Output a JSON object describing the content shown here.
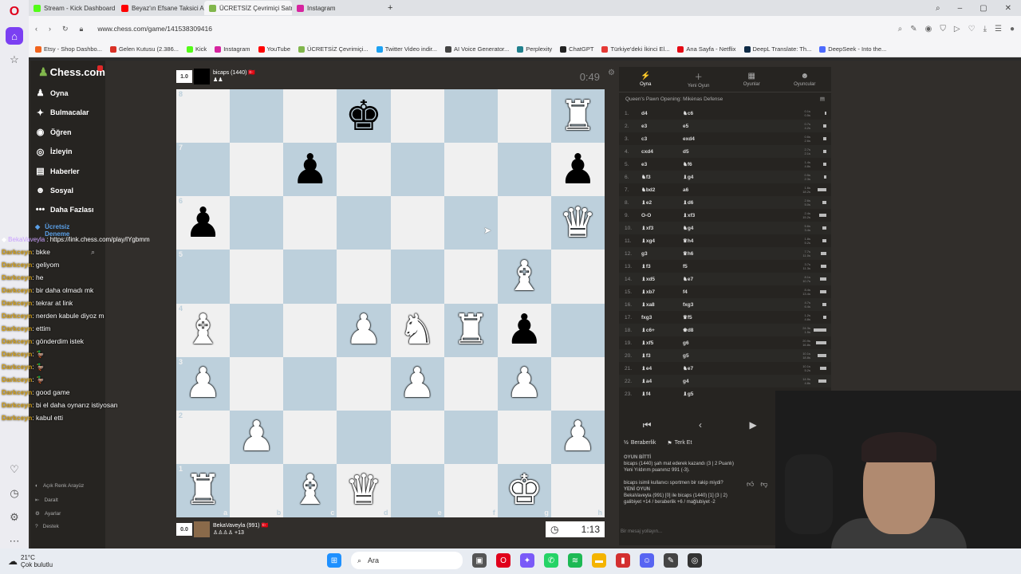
{
  "browser": {
    "tabs": [
      {
        "label": "Stream - Kick Dashboard",
        "color": "#53fc18"
      },
      {
        "label": "Beyaz'ın Efsane Taksici Anı",
        "color": "#ff0000"
      },
      {
        "label": "ÜCRETSİZ Çevrimiçi Satranç",
        "color": "#81b64c"
      },
      {
        "label": "Instagram",
        "color": "#d6249f"
      }
    ],
    "new_tab": "+",
    "url": "www.chess.com/game/141538309416",
    "bookmarks": [
      {
        "label": "Etsy - Shop Dashbo...",
        "color": "#f1641e"
      },
      {
        "label": "Gelen Kutusu (2.386...",
        "color": "#d93025"
      },
      {
        "label": "Kick",
        "color": "#53fc18"
      },
      {
        "label": "Instagram",
        "color": "#d6249f"
      },
      {
        "label": "YouTube",
        "color": "#ff0000"
      },
      {
        "label": "ÜCRETSİZ Çevrimiçi...",
        "color": "#81b64c"
      },
      {
        "label": "Twitter Video indir...",
        "color": "#1da1f2"
      },
      {
        "label": "AI Voice Generator...",
        "color": "#444444"
      },
      {
        "label": "Perplexity",
        "color": "#20808d"
      },
      {
        "label": "ChatGPT",
        "color": "#222222"
      },
      {
        "label": "Türkiye'deki İkinci El...",
        "color": "#e53935"
      },
      {
        "label": "Ana Sayfa - Netflix",
        "color": "#e50914"
      },
      {
        "label": "DeepL Translate: Th...",
        "color": "#0f2b46"
      },
      {
        "label": "DeepSeek - Into the...",
        "color": "#4d6bfe"
      }
    ]
  },
  "sidebar": {
    "logo": "Chess.com",
    "items": [
      {
        "label": "Oyna",
        "icon": "pawn-icon",
        "glyph": "♟"
      },
      {
        "label": "Bulmacalar",
        "icon": "puzzle-icon",
        "glyph": "✦"
      },
      {
        "label": "Öğren",
        "icon": "learn-icon",
        "glyph": "◉"
      },
      {
        "label": "İzleyin",
        "icon": "watch-icon",
        "glyph": "◎"
      },
      {
        "label": "Haberler",
        "icon": "news-icon",
        "glyph": "▤"
      },
      {
        "label": "Sosyal",
        "icon": "social-icon",
        "glyph": "☻"
      },
      {
        "label": "Daha Fazlası",
        "icon": "more-icon",
        "glyph": "•••"
      }
    ],
    "trial": "Ücretsiz Deneme",
    "bottom": [
      {
        "label": "Açık Renk Arayüz",
        "glyph": "◐"
      },
      {
        "label": "Daralt",
        "glyph": "⇤"
      },
      {
        "label": "Ayarlar",
        "glyph": "⚙"
      },
      {
        "label": "Destek",
        "glyph": "?"
      }
    ]
  },
  "chat": {
    "link_user": "BekaVaveyla",
    "link": ": https://link.chess.com/play/lYgbmm",
    "messages": [
      {
        "user": "Darkceyn",
        "text": ": bkke"
      },
      {
        "user": "Darkceyn",
        "text": ": geliyom"
      },
      {
        "user": "Darkceyn",
        "text": ": he"
      },
      {
        "user": "Darkceyn",
        "text": ": bir daha olmadı mk"
      },
      {
        "user": "Darkceyn",
        "text": ": tekrar at link"
      },
      {
        "user": "Darkceyn",
        "text": ": nerden kabule diyoz m"
      },
      {
        "user": "Darkceyn",
        "text": ": ettim"
      },
      {
        "user": "Darkceyn",
        "text": ": gönderdim istek"
      },
      {
        "user": "Darkceyn",
        "text": ": 🦆"
      },
      {
        "user": "Darkceyn",
        "text": ": 🦆"
      },
      {
        "user": "Darkceyn",
        "text": ": 🦆"
      },
      {
        "user": "Darkceyn",
        "text": ": good game"
      },
      {
        "user": "Darkceyn",
        "text": ": bi el daha oynarız istiyosan"
      },
      {
        "user": "Darkceyn",
        "text": ": kabul etti"
      }
    ]
  },
  "top_player": {
    "rating_badge": "1.0",
    "name": "bicaps (1440)",
    "flag": "🇹🇷",
    "captured": "♟♟",
    "clock": "0:49"
  },
  "bottom_player": {
    "rating_badge": "0.0",
    "name": "BekaVaveyla (991)",
    "flag": "🇹🇷",
    "captured": "♙♙♙♙ +13",
    "clock": "1:13"
  },
  "board": {
    "ranks": [
      "8",
      "7",
      "6",
      "5",
      "4",
      "3",
      "2",
      "1"
    ],
    "files": [
      "a",
      "b",
      "c",
      "d",
      "e",
      "f",
      "g",
      "h"
    ],
    "position": [
      [
        "",
        "",
        "",
        "bK",
        "",
        "",
        "",
        "wR"
      ],
      [
        "",
        "",
        "bP",
        "",
        "",
        "",
        "",
        "bP"
      ],
      [
        "bP",
        "",
        "",
        "",
        "",
        "",
        "",
        "wQ"
      ],
      [
        "",
        "",
        "",
        "",
        "",
        "",
        "wB",
        ""
      ],
      [
        "wB",
        "",
        "",
        "wP",
        "wN",
        "wR",
        "bP",
        ""
      ],
      [
        "wP",
        "",
        "",
        "",
        "wP",
        "",
        "wP",
        ""
      ],
      [
        "",
        "wP",
        "",
        "",
        "",
        "",
        "",
        "wP"
      ],
      [
        "wR",
        "",
        "wB",
        "wQ",
        "",
        "",
        "wK",
        ""
      ]
    ]
  },
  "right_panel": {
    "tabs": [
      {
        "label": "Oyna",
        "glyph": "⚡"
      },
      {
        "label": "Yeni Oyun",
        "glyph": "＋"
      },
      {
        "label": "Oyunlar",
        "glyph": "▦"
      },
      {
        "label": "Oyuncular",
        "glyph": "☻"
      }
    ],
    "opening": "Queen's Pawn Opening: Mikėnas Defense",
    "moves": [
      {
        "n": "1.",
        "w": "d4",
        "b": "♞c6",
        "tw": "0.1s",
        "tb": "0.5s",
        "bar": 0.1
      },
      {
        "n": "2.",
        "w": "e3",
        "b": "e5",
        "tw": "0.7s",
        "tb": "4.2s",
        "bar": 0.25
      },
      {
        "n": "3.",
        "w": "c3",
        "b": "exd4",
        "tw": "0.6s",
        "tb": "2.6s",
        "bar": 0.2
      },
      {
        "n": "4.",
        "w": "cxd4",
        "b": "d5",
        "tw": "2.7s",
        "tb": "2.1s",
        "bar": 0.22
      },
      {
        "n": "5.",
        "w": "e3",
        "b": "♞f6",
        "tw": "1.4s",
        "tb": "4.8s",
        "bar": 0.2
      },
      {
        "n": "6.",
        "w": "♞f3",
        "b": "♝g4",
        "tw": "0.5s",
        "tb": "2.3s",
        "bar": 0.15
      },
      {
        "n": "7.",
        "w": "♞bd2",
        "b": "a6",
        "tw": "1.6s",
        "tb": "18.2s",
        "bar": 0.6
      },
      {
        "n": "8.",
        "w": "♝e2",
        "b": "♝d6",
        "tw": "2.6s",
        "tb": "5.0s",
        "bar": 0.3
      },
      {
        "n": "9.",
        "w": "O-O",
        "b": "♝xf3",
        "tw": "2.4s",
        "tb": "15.2s",
        "bar": 0.5
      },
      {
        "n": "10.",
        "w": "♝xf3",
        "b": "♞g4",
        "tw": "5.6s",
        "tb": "3.4s",
        "bar": 0.3
      },
      {
        "n": "11.",
        "w": "♝xg4",
        "b": "♛h4",
        "tw": "1.8s",
        "tb": "5.2s",
        "bar": 0.3
      },
      {
        "n": "12.",
        "w": "g3",
        "b": "♛h6",
        "tw": "7.7s",
        "tb": "11.0s",
        "bar": 0.4
      },
      {
        "n": "13.",
        "w": "♝f3",
        "b": "f5",
        "tw": "3.7s",
        "tb": "11.3s",
        "bar": 0.4
      },
      {
        "n": "14.",
        "w": "♝xd5",
        "b": "♞e7",
        "tw": "8.1s",
        "tb": "10.7s",
        "bar": 0.45
      },
      {
        "n": "15.",
        "w": "♝xb7",
        "b": "f4",
        "tw": "8.4s",
        "tb": "13.4s",
        "bar": 0.45
      },
      {
        "n": "16.",
        "w": "♝xa8",
        "b": "fxg3",
        "tw": "4.7s",
        "tb": "6.4s",
        "bar": 0.3
      },
      {
        "n": "17.",
        "w": "fxg3",
        "b": "♛f5",
        "tw": "1.2s",
        "tb": "4.8s",
        "bar": 0.2
      },
      {
        "n": "18.",
        "w": "♝c6+",
        "b": "♚d8",
        "tw": "24.3s",
        "tb": "1.5s",
        "bar": 0.9
      },
      {
        "n": "19.",
        "w": "♝xf5",
        "b": "g6",
        "tw": "20.9s",
        "tb": "16.8s",
        "bar": 0.75
      },
      {
        "n": "20.",
        "w": "♝f3",
        "b": "g5",
        "tw": "10.1s",
        "tb": "18.8s",
        "bar": 0.6
      },
      {
        "n": "21.",
        "w": "♝e4",
        "b": "♞e7",
        "tw": "10.1s",
        "tb": "5.2s",
        "bar": 0.45
      },
      {
        "n": "22.",
        "w": "♝a4",
        "b": "g4",
        "tw": "14.9s",
        "tb": "4.8s",
        "bar": 0.55
      },
      {
        "n": "23.",
        "w": "♝f4",
        "b": "♝g5",
        "tw": "",
        "tb": "",
        "bar": 0
      }
    ],
    "nav": [
      "⏮",
      "‹",
      "▶",
      "›"
    ],
    "actions": [
      {
        "label": "Beraberlik",
        "glyph": "½"
      },
      {
        "label": "Terk Et",
        "glyph": "⚑"
      }
    ],
    "log": [
      {
        "text": "OYUN BİTTİ",
        "hd": true
      },
      {
        "text": "bicaps (1440) şah mat ederek kazandı (3 | 2 Puanlı)",
        "hd": false
      },
      {
        "text": "Yeni Yıldırım puanınız 991 (-3).",
        "hd": false
      },
      {
        "text": "",
        "hd": false
      },
      {
        "text": "bicaps isimli kullanıcı sportmen bir rakip miydi?",
        "hd": false
      },
      {
        "text": "YENİ OYUN",
        "hd": true
      },
      {
        "text": "BekaVaveyla (991) [0] ile bicaps (1440) [1] (3 | 2)",
        "hd": false
      },
      {
        "text": "galibiyet +14 / beraberlik +6 / mağlubiyet -2",
        "hd": false
      }
    ],
    "message_placeholder": "Bir mesaj yollayın..."
  },
  "taskbar": {
    "temp": "21°C",
    "weather": "Çok bulutlu",
    "search": "Ara"
  }
}
